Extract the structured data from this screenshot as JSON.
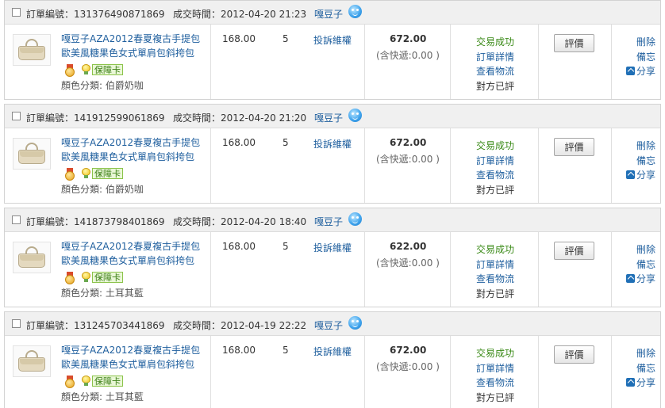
{
  "labels": {
    "order_no": "訂單編號：",
    "deal_time": "成交時間：",
    "complaint": "投訴維權",
    "review": "評價",
    "delete": "刪除",
    "memo": "備忘",
    "share": "分享",
    "trade_success": "交易成功",
    "order_detail": "訂單詳情",
    "view_logistics": "查看物流",
    "other_reviewed": "對方已評",
    "guarantee_card": "保障卡"
  },
  "orders": [
    {
      "order_no": "131376490871869",
      "deal_time": "2012-04-20 21:23",
      "seller": "嘎豆子",
      "title": "嘎豆子AZA2012春夏複古手提包歐美風糖果色女式單肩包斜挎包",
      "price": "168.00",
      "quantity": "5",
      "total": "672.00",
      "shipping": "(含快遞:0.00 )",
      "color_attr": "顏色分類: 伯爵奶咖"
    },
    {
      "order_no": "141912599061869",
      "deal_time": "2012-04-20 21:20",
      "seller": "嘎豆子",
      "title": "嘎豆子AZA2012春夏複古手提包歐美風糖果色女式單肩包斜挎包",
      "price": "168.00",
      "quantity": "5",
      "total": "672.00",
      "shipping": "(含快遞:0.00 )",
      "color_attr": "顏色分類: 伯爵奶咖"
    },
    {
      "order_no": "141873798401869",
      "deal_time": "2012-04-20 18:40",
      "seller": "嘎豆子",
      "title": "嘎豆子AZA2012春夏複古手提包歐美風糖果色女式單肩包斜挎包",
      "price": "168.00",
      "quantity": "5",
      "total": "622.00",
      "shipping": "(含快遞:0.00 )",
      "color_attr": "顏色分類: 土耳其藍"
    },
    {
      "order_no": "131245703441869",
      "deal_time": "2012-04-19 22:22",
      "seller": "嘎豆子",
      "title": "嘎豆子AZA2012春夏複古手提包歐美風糖果色女式單肩包斜挎包",
      "price": "168.00",
      "quantity": "5",
      "total": "672.00",
      "shipping": "(含快遞:0.00 )",
      "color_attr": "顏色分類: 土耳其藍"
    }
  ]
}
